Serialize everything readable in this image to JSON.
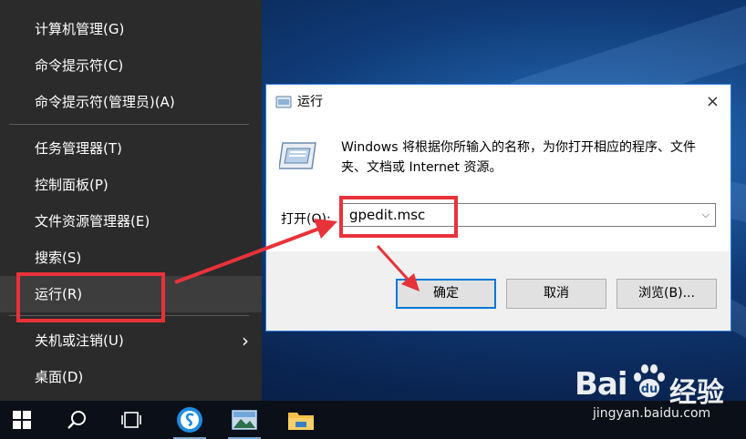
{
  "context_menu": {
    "items": [
      {
        "label": "计算机管理(G)"
      },
      {
        "label": "命令提示符(C)"
      },
      {
        "label": "命令提示符(管理员)(A)"
      },
      {
        "label": "任务管理器(T)"
      },
      {
        "label": "控制面板(P)"
      },
      {
        "label": "文件资源管理器(E)"
      },
      {
        "label": "搜索(S)"
      },
      {
        "label": "运行(R)"
      },
      {
        "label": "关机或注销(U)"
      },
      {
        "label": "桌面(D)"
      }
    ],
    "submenu_arrow": "›"
  },
  "run_dialog": {
    "title": "运行",
    "close": "×",
    "description": "Windows 将根据你所输入的名称，为你打开相应的程序、文件夹、文档或 Internet 资源。",
    "open_label": "打开(O):",
    "open_value": "gpedit.msc",
    "dropdown_glyph": "⌵",
    "ok_label": "确定",
    "cancel_label": "取消",
    "browse_label": "浏览(B)..."
  },
  "taskbar": {
    "icons": [
      "windows-start-icon",
      "search-icon",
      "task-view-icon",
      "sogou-browser-icon",
      "photos-icon",
      "file-explorer-icon"
    ]
  },
  "watermark": {
    "brand": "Bai",
    "brand_suffix": "经验",
    "url": "jingyan.baidu.com"
  },
  "colors": {
    "menu_bg": "#2b2b2b",
    "accent": "#0078d7",
    "highlight_red": "#e8323a"
  }
}
